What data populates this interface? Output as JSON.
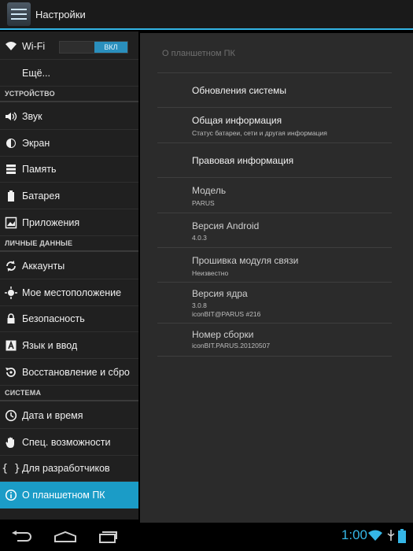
{
  "action_bar": {
    "title": "Настройки",
    "icon": "settings-app-icon"
  },
  "sidebar": {
    "wifi": {
      "label": "Wi-Fi",
      "toggle": "ВКЛ",
      "icon": "wifi-icon"
    },
    "more": {
      "label": "Ещё..."
    },
    "section_device": "УСТРОЙСТВО",
    "device_items": [
      {
        "label": "Звук",
        "icon": "volume-icon"
      },
      {
        "label": "Экран",
        "icon": "brightness-icon"
      },
      {
        "label": "Память",
        "icon": "storage-icon"
      },
      {
        "label": "Батарея",
        "icon": "battery-icon"
      },
      {
        "label": "Приложения",
        "icon": "apps-icon"
      }
    ],
    "section_personal": "ЛИЧНЫЕ ДАННЫЕ",
    "personal_items": [
      {
        "label": "Аккаунты",
        "icon": "sync-icon"
      },
      {
        "label": "Мое местоположение",
        "icon": "location-icon"
      },
      {
        "label": "Безопасность",
        "icon": "lock-icon"
      },
      {
        "label": "Язык и ввод",
        "icon": "keyboard-a-icon"
      },
      {
        "label": "Восстановление и сбро",
        "icon": "backup-restore-icon"
      }
    ],
    "section_system": "СИСТЕМА",
    "system_items": [
      {
        "label": "Дата и время",
        "icon": "clock-icon"
      },
      {
        "label": "Спец. возможности",
        "icon": "hand-icon"
      },
      {
        "label": "Для разработчиков",
        "icon": "braces-icon"
      },
      {
        "label": "О планшетном ПК",
        "icon": "info-icon",
        "selected": true
      }
    ]
  },
  "content": {
    "breadcrumb": "О планшетном ПК",
    "items": [
      {
        "title": "Обновления системы"
      },
      {
        "title": "Общая информация",
        "subtitle": "Статус батареи, сети и другая информация"
      },
      {
        "title": "Правовая информация"
      },
      {
        "title": "Модель",
        "subtitle": "PARUS"
      },
      {
        "title": "Версия Android",
        "subtitle": "4.0.3"
      },
      {
        "title": "Прошивка модуля связи",
        "subtitle": "Неизвестно"
      },
      {
        "title": "Версия ядра",
        "subtitle": "3.0.8",
        "subtitle2": "iconBIT@PARUS #216"
      },
      {
        "title": "Номер сборки",
        "subtitle": "iconBIT.PARUS.20120507"
      }
    ]
  },
  "navbar": {
    "clock": "1:00",
    "buttons": [
      "back-icon",
      "home-icon",
      "recents-icon"
    ]
  },
  "colors": {
    "accent": "#33b5e5",
    "selected": "#1b9cc7",
    "background": "#202020"
  }
}
